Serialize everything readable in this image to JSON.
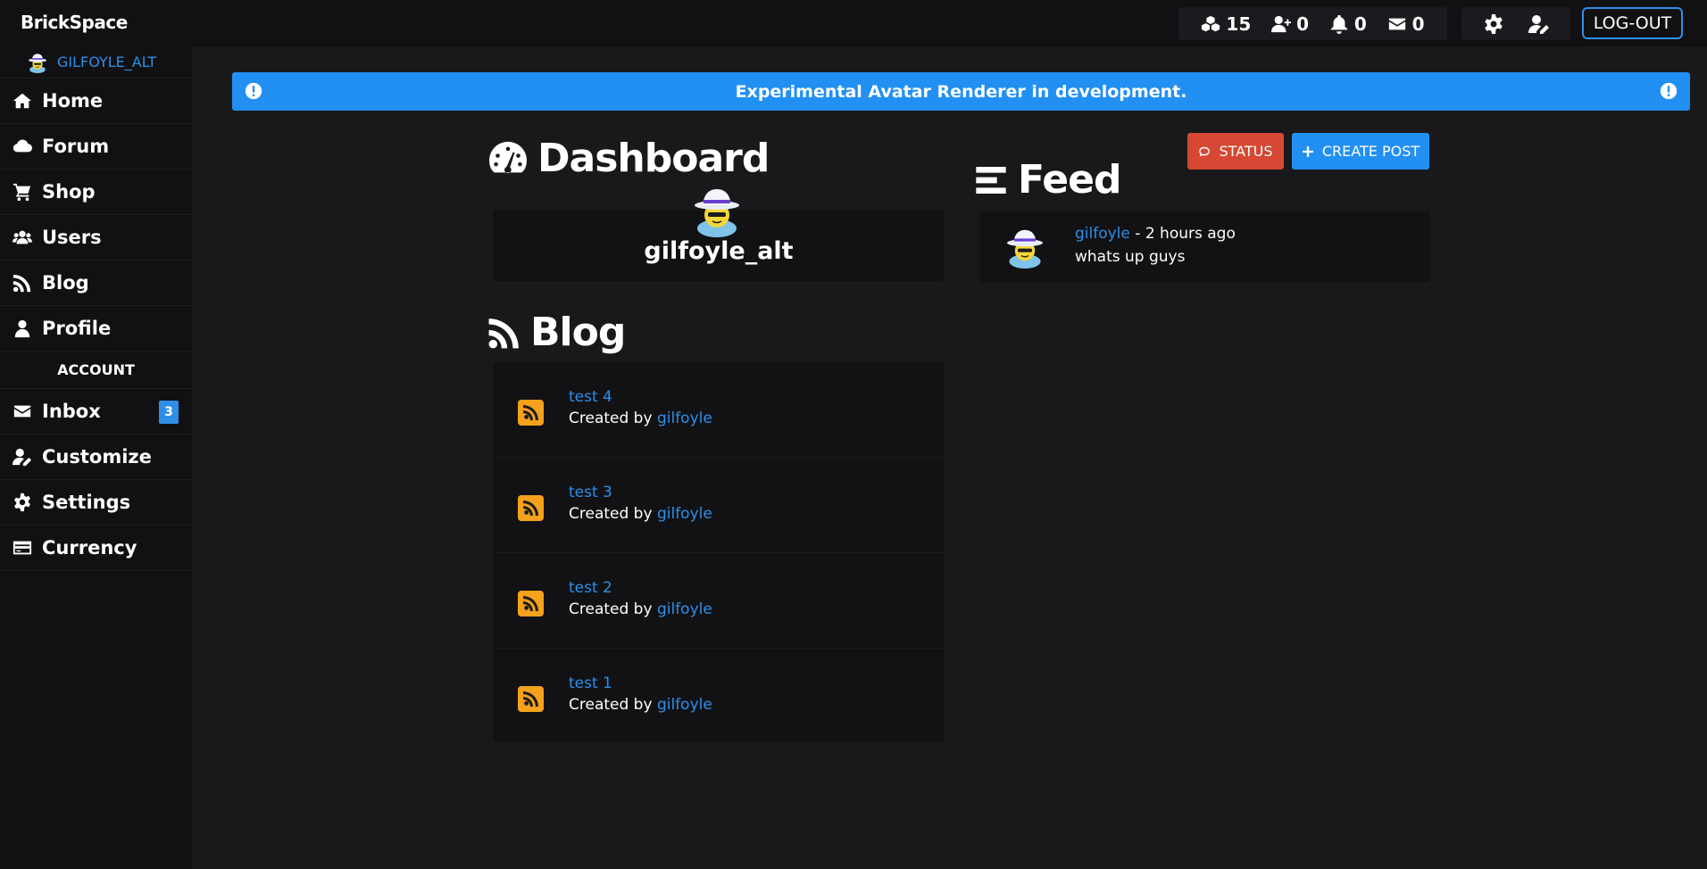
{
  "app": {
    "name": "BrickSpace"
  },
  "topbar": {
    "stats": [
      {
        "icon": "bricks-icon",
        "value": "15"
      },
      {
        "icon": "user-plus-icon",
        "value": "0"
      },
      {
        "icon": "bell-icon",
        "value": "0"
      },
      {
        "icon": "envelope-icon",
        "value": "0"
      }
    ],
    "logout_label": "LOG-OUT"
  },
  "sidebar": {
    "username": "GILFOYLE_ALT",
    "items": [
      {
        "label": "Home",
        "icon": "home-icon"
      },
      {
        "label": "Forum",
        "icon": "cloud-icon"
      },
      {
        "label": "Shop",
        "icon": "cart-icon"
      },
      {
        "label": "Users",
        "icon": "users-icon"
      },
      {
        "label": "Blog",
        "icon": "rss-icon"
      },
      {
        "label": "Profile",
        "icon": "user-icon"
      }
    ],
    "account_header": "ACCOUNT",
    "account_items": [
      {
        "label": "Inbox",
        "icon": "envelope-icon",
        "badge": "3"
      },
      {
        "label": "Customize",
        "icon": "user-edit-icon"
      },
      {
        "label": "Settings",
        "icon": "gear-icon"
      },
      {
        "label": "Currency",
        "icon": "card-icon"
      }
    ]
  },
  "alert": {
    "text": "Experimental Avatar Renderer in development."
  },
  "dashboard": {
    "title": "Dashboard",
    "username": "gilfoyle_alt"
  },
  "blog": {
    "title": "Blog",
    "created_by_label": "Created by",
    "posts": [
      {
        "title": "test 4",
        "author": "gilfoyle"
      },
      {
        "title": "test 3",
        "author": "gilfoyle"
      },
      {
        "title": "test 2",
        "author": "gilfoyle"
      },
      {
        "title": "test 1",
        "author": "gilfoyle"
      }
    ]
  },
  "feed": {
    "title": "Feed",
    "status_button": "STATUS",
    "create_button": "CREATE POST",
    "posts": [
      {
        "author": "gilfoyle",
        "time": "- 2 hours ago",
        "body": "whats up guys"
      }
    ]
  },
  "colors": {
    "accent": "#2290f2",
    "link": "#2e8fe8",
    "danger": "#d64833",
    "rss": "#f4a11d"
  }
}
